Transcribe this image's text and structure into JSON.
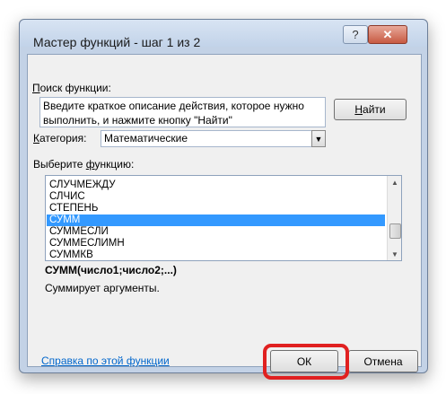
{
  "window": {
    "title": "Мастер функций - шаг 1 из 2",
    "help_button": "?",
    "close_button": "✕"
  },
  "search": {
    "label_accel": "П",
    "label_rest": "оиск функции:",
    "text": "Введите краткое описание действия, которое нужно выполнить, и нажмите кнопку \"Найти\"",
    "find_accel": "Н",
    "find_rest": "айти"
  },
  "category": {
    "label_accel": "К",
    "label_rest": "атегория:",
    "value": "Математические",
    "dropdown_icon": "▼"
  },
  "function_list": {
    "label_prefix": "Выберите ",
    "label_accel": "ф",
    "label_suffix": "ункцию:",
    "items": [
      "СЛУЧМЕЖДУ",
      "СЛЧИС",
      "СТЕПЕНЬ",
      "СУММ",
      "СУММЕСЛИ",
      "СУММЕСЛИМН",
      "СУММКВ"
    ],
    "selected_index": 3,
    "scroll_up": "▲",
    "scroll_down": "▼"
  },
  "selected_function": {
    "signature": "СУММ(число1;число2;...)",
    "description": "Суммирует аргументы."
  },
  "footer": {
    "help_link": "Справка по этой функции",
    "ok": "ОК",
    "cancel": "Отмена"
  },
  "colors": {
    "selection": "#3399ff",
    "highlight_ring": "#e02020",
    "link": "#0066cc"
  }
}
